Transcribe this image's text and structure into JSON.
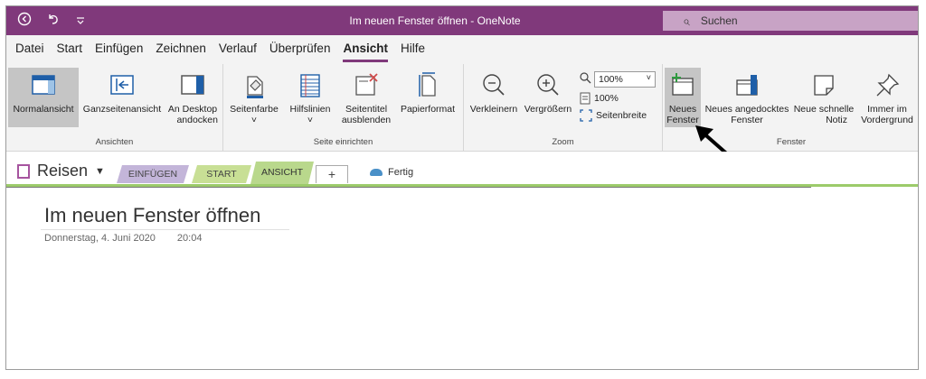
{
  "titlebar": {
    "title": "Im neuen Fenster öffnen  -  OneNote",
    "back_icon": "back-arrow-icon",
    "undo_icon": "undo-icon",
    "qat_icon": "qat-dropdown-icon"
  },
  "search": {
    "placeholder": "Suchen"
  },
  "menu": [
    "Datei",
    "Start",
    "Einfügen",
    "Zeichnen",
    "Verlauf",
    "Überprüfen",
    "Ansicht",
    "Hilfe"
  ],
  "ribbon": {
    "views": {
      "normal": "Normalansicht",
      "fullpage": "Ganzseitenansicht",
      "dock_l1": "An Desktop",
      "dock_l2": "andocken",
      "label": "Ansichten"
    },
    "page_setup": {
      "color": "Seitenfarbe",
      "rules": "Hilfslinien",
      "hide_l1": "Seitentitel",
      "hide_l2": "ausblenden",
      "paper": "Papierformat",
      "label": "Seite einrichten",
      "caret": "˅"
    },
    "zoom": {
      "out": "Verkleinern",
      "in": "Vergrößern",
      "zoom_value": "100%",
      "hundred": "100%",
      "page_width": "Seitenbreite",
      "label": "Zoom"
    },
    "window": {
      "new_l1": "Neues",
      "new_l2": "Fenster",
      "docked_l1": "Neues angedocktes",
      "docked_l2": "Fenster",
      "quick_l1": "Neue schnelle",
      "quick_l2": "Notiz",
      "ontop_l1": "Immer im",
      "ontop_l2": "Vordergrund",
      "label": "Fenster"
    }
  },
  "notebook": {
    "name": "Reisen",
    "tabs": [
      "EINFÜGEN",
      "START",
      "ANSICHT",
      "+"
    ],
    "status": "Fertig"
  },
  "page": {
    "title": "Im neuen Fenster öffnen",
    "date": "Donnerstag, 4. Juni 2020",
    "time": "20:04"
  },
  "colors": {
    "brand": "#80397b",
    "search_bg": "#c8a3c5",
    "tab_einfuegen": "#c3b5d9",
    "tab_start": "#c8df95",
    "tab_ansicht": "#b9d88c"
  }
}
